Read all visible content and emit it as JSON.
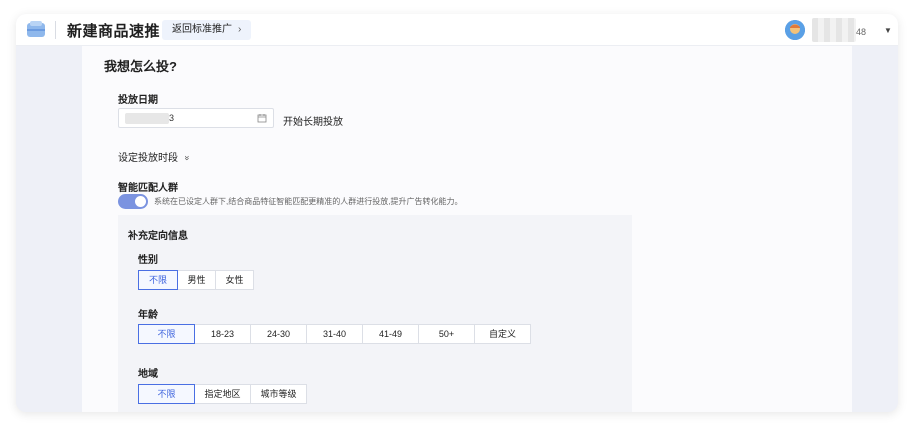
{
  "header": {
    "app_title": "新建商品速推",
    "back_label": "返回标准推广",
    "back_chevron": "›",
    "user_suffix": "48",
    "dropdown_caret": "▼"
  },
  "form": {
    "section_title": "我想怎么投?",
    "date": {
      "label": "投放日期",
      "value": "3",
      "long_term_label": "开始长期投放"
    },
    "time_slot_label": "设定投放时段",
    "time_slot_chevron": "»",
    "smart_crowd": {
      "label": "智能匹配人群",
      "enabled": true,
      "hint": "系统在已设定人群下,结合商品特征智能匹配更精准的人群进行投放,提升广告转化能力。"
    },
    "targeting": {
      "title": "补充定向信息",
      "gender": {
        "label": "性别",
        "options": [
          "不限",
          "男性",
          "女性"
        ],
        "selected": "不限"
      },
      "age": {
        "label": "年龄",
        "options": [
          "不限",
          "18-23",
          "24-30",
          "31-40",
          "41-49",
          "50+",
          "自定义"
        ],
        "selected": "不限"
      },
      "region": {
        "label": "地域",
        "options": [
          "不限",
          "指定地区",
          "城市等级"
        ],
        "selected": "不限"
      }
    }
  },
  "colors": {
    "accent": "#3d63dd",
    "toggle_on": "#7b93e0",
    "background": "#eef0f7"
  }
}
